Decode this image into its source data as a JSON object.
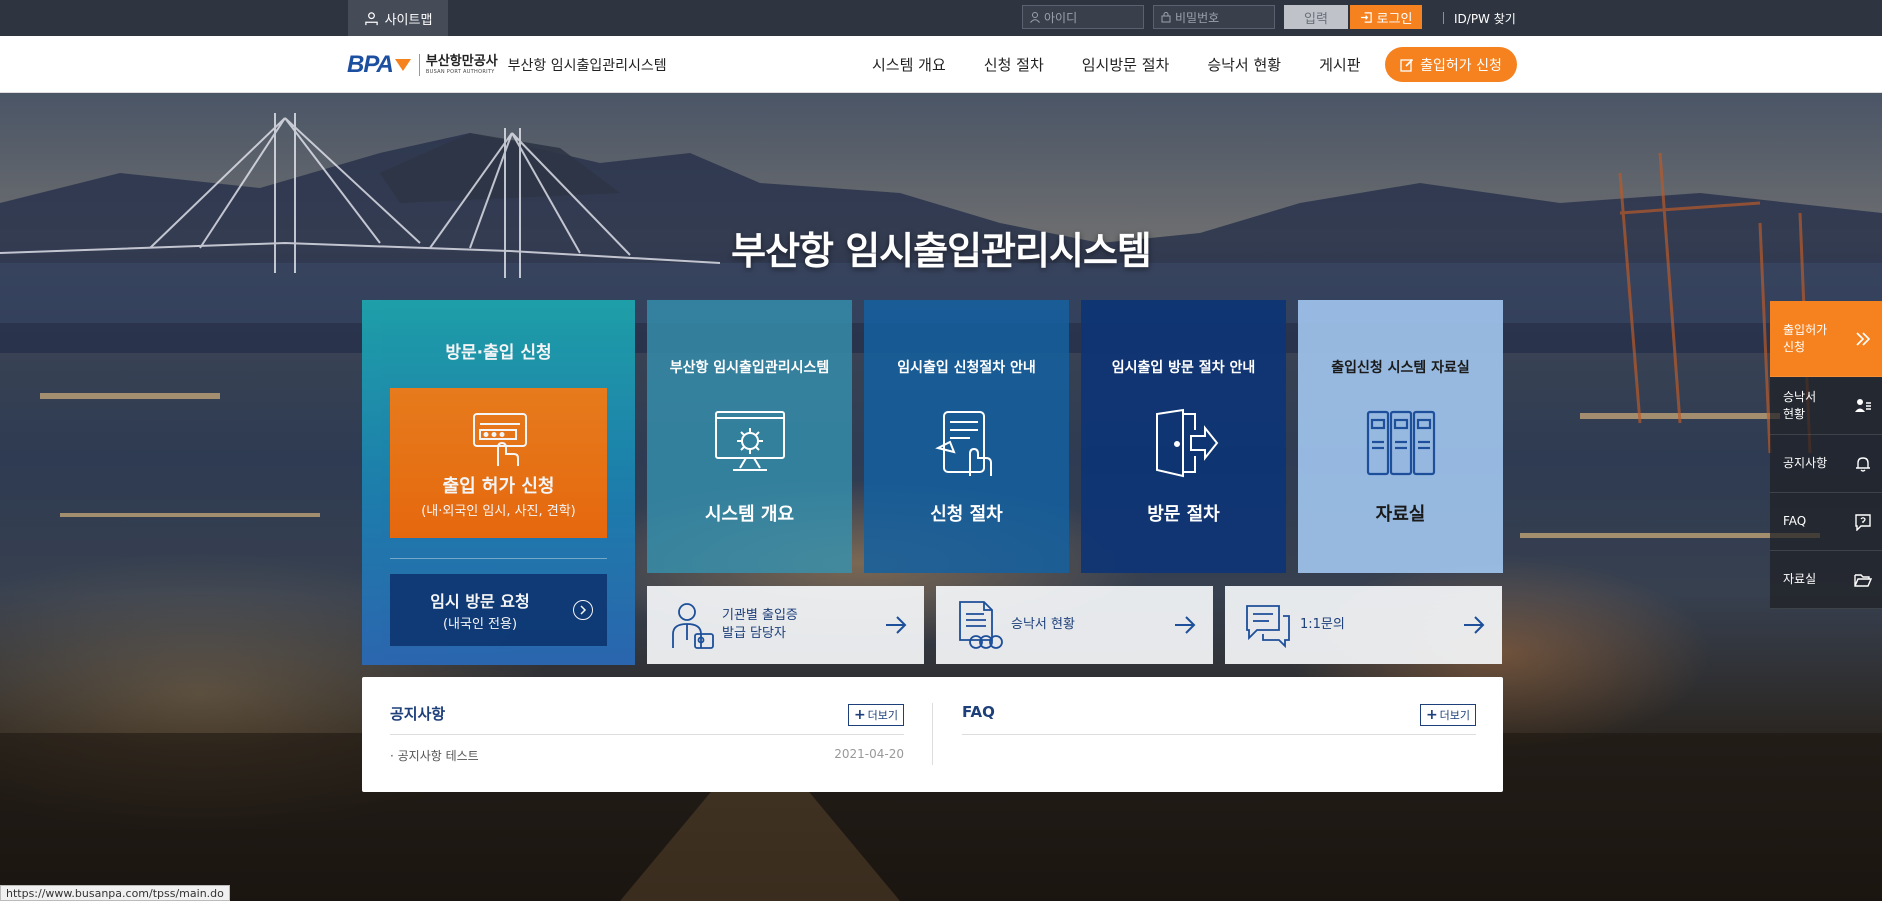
{
  "topbar": {
    "sitemap": "사이트맵",
    "id_placeholder": "아이디",
    "pw_placeholder": "비밀번호",
    "input_btn": "입력",
    "login_btn": "로그인",
    "idpw_find": "ID/PW 찾기"
  },
  "header": {
    "logo_brand": "BPA",
    "logo_kor": "부산항만공사",
    "logo_eng": "BUSAN PORT AUTHORITY",
    "system_name": "부산항 임시출입관리시스템",
    "nav": [
      "시스템 개요",
      "신청 절차",
      "임시방문 절차",
      "승낙서 현황",
      "게시판"
    ],
    "cta": "출입허가 신청"
  },
  "hero": {
    "title": "부산항 임시출입관리시스템"
  },
  "visit": {
    "title": "방문·출입 신청",
    "apply_main": "출입 허가 신청",
    "apply_sub": "(내·외국인 임시, 사진, 견학)",
    "request_main": "임시 방문 요청",
    "request_sub": "(내국인 전용)"
  },
  "tiles": [
    {
      "head": "부산항 임시출입관리시스템",
      "foot": "시스템 개요",
      "icon": "monitor-gear-icon"
    },
    {
      "head": "임시출입 신청절차 안내",
      "foot": "신청 절차",
      "icon": "tablet-touch-icon"
    },
    {
      "head": "임시출입 방문 절차 안내",
      "foot": "방문 절차",
      "icon": "door-enter-icon"
    },
    {
      "head": "출입신청 시스템 자료실",
      "foot": "자료실",
      "icon": "binders-icon"
    }
  ],
  "quick": [
    {
      "text": "기관별 출입증\n발급 담당자",
      "icon": "person-id-icon"
    },
    {
      "text": "승낙서 현황",
      "icon": "document-coins-icon"
    },
    {
      "text": "1:1문의",
      "icon": "chat-bubble-icon"
    }
  ],
  "board": {
    "notice_title": "공지사항",
    "faq_title": "FAQ",
    "more": "더보기",
    "notices": [
      {
        "title": "· 공지사항 테스트",
        "date": "2021-04-20"
      }
    ]
  },
  "quickmenu": [
    {
      "label": "출입허가\n신청",
      "icon": "double-chevron-icon"
    },
    {
      "label": "승낙서\n현황",
      "icon": "user-list-icon"
    },
    {
      "label": "공지사항",
      "icon": "bell-icon"
    },
    {
      "label": "FAQ",
      "icon": "question-bubble-icon"
    },
    {
      "label": "자료실",
      "icon": "folder-open-icon"
    }
  ],
  "status_url": "https://www.busanpa.com/tpss/main.do",
  "colors": {
    "accent": "#f5821f",
    "navy": "#1d3f7a",
    "teal": "#1da4ad"
  }
}
